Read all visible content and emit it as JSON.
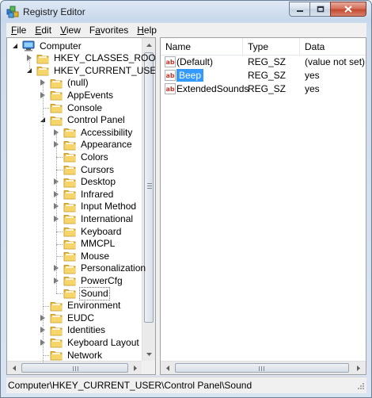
{
  "window": {
    "title": "Registry Editor"
  },
  "menu": [
    {
      "label": "File",
      "accel": "F",
      "rest": "ile"
    },
    {
      "label": "Edit",
      "accel": "E",
      "rest": "dit"
    },
    {
      "label": "View",
      "accel": "V",
      "rest": "iew"
    },
    {
      "label": "Favorites",
      "accel": "a",
      "pre": "F",
      "rest": "vorites"
    },
    {
      "label": "Help",
      "accel": "H",
      "rest": "elp"
    }
  ],
  "tree": {
    "computer": "Computer",
    "hkcr": "HKEY_CLASSES_ROOT",
    "hkcu": "HKEY_CURRENT_USER",
    "null": "(null)",
    "appevents": "AppEvents",
    "console": "Console",
    "control_panel": "Control Panel",
    "children": [
      {
        "label": "Accessibility",
        "expandable": true
      },
      {
        "label": "Appearance",
        "expandable": true
      },
      {
        "label": "Colors",
        "expandable": false
      },
      {
        "label": "Cursors",
        "expandable": false
      },
      {
        "label": "Desktop",
        "expandable": true
      },
      {
        "label": "Infrared",
        "expandable": true
      },
      {
        "label": "Input Method",
        "expandable": true
      },
      {
        "label": "International",
        "expandable": true
      },
      {
        "label": "Keyboard",
        "expandable": false
      },
      {
        "label": "MMCPL",
        "expandable": false
      },
      {
        "label": "Mouse",
        "expandable": false
      },
      {
        "label": "Personalization",
        "expandable": true
      },
      {
        "label": "PowerCfg",
        "expandable": true
      },
      {
        "label": "Sound",
        "expandable": false,
        "selected": true
      }
    ],
    "siblings": [
      {
        "label": "Environment",
        "expandable": false
      },
      {
        "label": "EUDC",
        "expandable": true
      },
      {
        "label": "Identities",
        "expandable": true
      },
      {
        "label": "Keyboard Layout",
        "expandable": true
      },
      {
        "label": "Network",
        "expandable": false
      }
    ]
  },
  "list": {
    "columns": {
      "name": "Name",
      "type": "Type",
      "data": "Data"
    },
    "rows": [
      {
        "name": "(Default)",
        "type": "REG_SZ",
        "data": "(value not set)",
        "selected": false
      },
      {
        "name": "Beep",
        "type": "REG_SZ",
        "data": "yes",
        "selected": true
      },
      {
        "name": "ExtendedSounds",
        "type": "REG_SZ",
        "data": "yes",
        "selected": false
      }
    ]
  },
  "status": {
    "path": "Computer\\HKEY_CURRENT_USER\\Control Panel\\Sound"
  },
  "icons": {
    "app": "registry-editor-icon",
    "computer": "computer-icon",
    "folder": "folder-icon",
    "value": "string-value-icon"
  },
  "colors": {
    "selection": "#3399ff",
    "folder": "#f0c33c"
  }
}
